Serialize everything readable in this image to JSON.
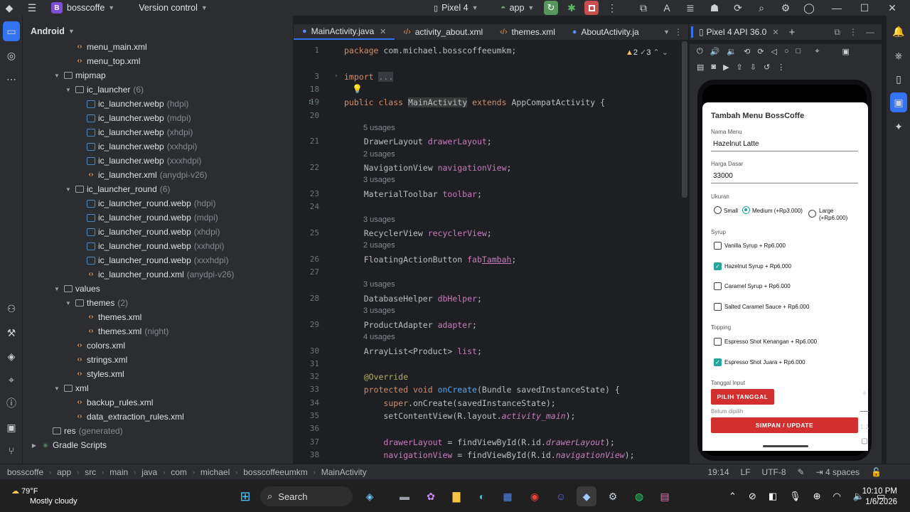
{
  "titlebar": {
    "project_initial": "B",
    "project": "bosscoffe",
    "vcs": "Version control",
    "device": "Pixel 4",
    "run_config": "app"
  },
  "project": {
    "view": "Android",
    "tree": [
      {
        "d": 4,
        "t": "xml",
        "label": "menu_main.xml",
        "gray": ""
      },
      {
        "d": 4,
        "t": "xml",
        "label": "menu_top.xml",
        "gray": ""
      },
      {
        "d": 3,
        "t": "folder",
        "label": "mipmap",
        "gray": "",
        "open": true
      },
      {
        "d": 4,
        "t": "folder",
        "label": "ic_launcher",
        "gray": "(6)",
        "open": true
      },
      {
        "d": 5,
        "t": "img",
        "label": "ic_launcher.webp",
        "gray": "(hdpi)"
      },
      {
        "d": 5,
        "t": "img",
        "label": "ic_launcher.webp",
        "gray": "(mdpi)"
      },
      {
        "d": 5,
        "t": "img",
        "label": "ic_launcher.webp",
        "gray": "(xhdpi)"
      },
      {
        "d": 5,
        "t": "img",
        "label": "ic_launcher.webp",
        "gray": "(xxhdpi)"
      },
      {
        "d": 5,
        "t": "img",
        "label": "ic_launcher.webp",
        "gray": "(xxxhdpi)"
      },
      {
        "d": 5,
        "t": "xml",
        "label": "ic_launcher.xml",
        "gray": "(anydpi-v26)"
      },
      {
        "d": 4,
        "t": "folder",
        "label": "ic_launcher_round",
        "gray": "(6)",
        "open": true
      },
      {
        "d": 5,
        "t": "img",
        "label": "ic_launcher_round.webp",
        "gray": "(hdpi)"
      },
      {
        "d": 5,
        "t": "img",
        "label": "ic_launcher_round.webp",
        "gray": "(mdpi)"
      },
      {
        "d": 5,
        "t": "img",
        "label": "ic_launcher_round.webp",
        "gray": "(xhdpi)"
      },
      {
        "d": 5,
        "t": "img",
        "label": "ic_launcher_round.webp",
        "gray": "(xxhdpi)"
      },
      {
        "d": 5,
        "t": "img",
        "label": "ic_launcher_round.webp",
        "gray": "(xxxhdpi)"
      },
      {
        "d": 5,
        "t": "xml",
        "label": "ic_launcher_round.xml",
        "gray": "(anydpi-v26)"
      },
      {
        "d": 3,
        "t": "folder",
        "label": "values",
        "gray": "",
        "open": true
      },
      {
        "d": 4,
        "t": "folder",
        "label": "themes",
        "gray": "(2)",
        "open": true
      },
      {
        "d": 5,
        "t": "xml",
        "label": "themes.xml",
        "gray": ""
      },
      {
        "d": 5,
        "t": "xml",
        "label": "themes.xml",
        "gray": "(night)"
      },
      {
        "d": 4,
        "t": "xml",
        "label": "colors.xml",
        "gray": ""
      },
      {
        "d": 4,
        "t": "xml",
        "label": "strings.xml",
        "gray": ""
      },
      {
        "d": 4,
        "t": "xml",
        "label": "styles.xml",
        "gray": ""
      },
      {
        "d": 3,
        "t": "folder",
        "label": "xml",
        "gray": "",
        "open": true
      },
      {
        "d": 4,
        "t": "xml",
        "label": "backup_rules.xml",
        "gray": ""
      },
      {
        "d": 4,
        "t": "xml",
        "label": "data_extraction_rules.xml",
        "gray": ""
      },
      {
        "d": 2,
        "t": "folder",
        "label": "res",
        "gray": "(generated)"
      },
      {
        "d": 1,
        "t": "gradle",
        "label": "Gradle Scripts",
        "gray": "",
        "closed": true
      }
    ]
  },
  "tabs": [
    "MainActivity.java",
    "activity_about.xml",
    "themes.xml",
    "AboutActivity.ja"
  ],
  "editor": {
    "warnings": "2",
    "weak": "3",
    "lines": [
      {
        "n": "1",
        "html": "<span class='kw'>package</span> com.michael.bosscoffeeumkm;"
      },
      {
        "n": "",
        "html": ""
      },
      {
        "n": "3",
        "html": "<span class='kw'>import</span> <span style='background:#393b40;color:#868a91'>...</span>"
      },
      {
        "n": "18",
        "html": ""
      },
      {
        "n": "19",
        "html": "<span class='kw'>public class</span> <span style='background:#373b39'>MainActivity</span> <span class='kw'>extends</span> AppCompatActivity {"
      },
      {
        "n": "20",
        "html": ""
      },
      {
        "n": "21",
        "u": "5 usages",
        "html": "    DrawerLayout <span class='fld'>drawerLayout</span>;"
      },
      {
        "n": "22",
        "u": "2 usages",
        "html": "    NavigationView <span class='fld'>navigationView</span>;"
      },
      {
        "n": "23",
        "u": "3 usages",
        "html": "    MaterialToolbar <span class='fld'>toolbar</span>;"
      },
      {
        "n": "24",
        "html": ""
      },
      {
        "n": "25",
        "u": "3 usages",
        "html": "    RecyclerView <span class='fld'>recyclerView</span>;"
      },
      {
        "n": "26",
        "u": "2 usages",
        "html": "    FloatingActionButton <span class='fld'>fab<u>Tambah</u></span>;"
      },
      {
        "n": "27",
        "html": ""
      },
      {
        "n": "28",
        "u": "3 usages",
        "html": "    DatabaseHelper <span class='fld'>dbHelper</span>;"
      },
      {
        "n": "29",
        "u": "3 usages",
        "html": "    ProductAdapter <span class='fld'>adapter</span>;"
      },
      {
        "n": "30",
        "u": "4 usages",
        "html": "    ArrayList&lt;Product&gt; <span class='fld'>list</span>;"
      },
      {
        "n": "31",
        "html": ""
      },
      {
        "n": "32",
        "html": "    <span class='an'>@Override</span>"
      },
      {
        "n": "33",
        "html": "    <span class='kw'>protected void</span> <span class='fn'>onCreate</span>(Bundle savedInstanceState) {"
      },
      {
        "n": "34",
        "html": "        <span class='kw'>super</span>.onCreate(savedInstanceState);"
      },
      {
        "n": "35",
        "html": "        setContentView(R.layout.<span class='it'>activity_main</span>);"
      },
      {
        "n": "36",
        "html": ""
      },
      {
        "n": "37",
        "html": "        <span class='fld'>drawerLayout</span> = findViewById(R.id.<span class='it'>drawerLayout</span>);"
      },
      {
        "n": "38",
        "html": "        <span class='fld'>navigationView</span> = findViewById(R.id.<span class='it'>navigationView</span>);"
      }
    ]
  },
  "emulator": {
    "title": "Pixel 4 API 36.0"
  },
  "app": {
    "title": "Tambah Menu BossCoffe",
    "nama_label": "Nama Menu",
    "nama_value": "Hazelnut Latte",
    "harga_label": "Harga Dasar",
    "harga_value": "33000",
    "ukuran_label": "Ukuran",
    "sizes": [
      "Small",
      "Medium (+Rp3.000)",
      "Large (+Rp6.000)"
    ],
    "size_selected": "Medium (+Rp3.000)",
    "syrup_label": "Syrup",
    "syrups": [
      {
        "label": "Vanilla Syrup + Rp6.000",
        "checked": false
      },
      {
        "label": "Hazelnut Syrup + Rp6.000",
        "checked": true
      },
      {
        "label": "Caramel Syrup + Rp6.000",
        "checked": false
      },
      {
        "label": "Salted Caramel Sauce + Rp6.000",
        "checked": false
      }
    ],
    "topping_label": "Topping",
    "toppings": [
      {
        "label": "Espresso Shot Kenangan + Rp6.000",
        "checked": false
      },
      {
        "label": "Espresso Shot Juara + Rp6.000",
        "checked": true
      }
    ],
    "tanggal_label": "Tanggal Input",
    "pilih_button": "PILIH TANGGAL",
    "belum": "Belum dipilih",
    "simpan_button": "SIMPAN / UPDATE",
    "zoom_ratio": "1:1"
  },
  "status": {
    "crumbs": [
      "bosscoffe",
      "app",
      "src",
      "main",
      "java",
      "com",
      "michael",
      "bosscoffeeumkm",
      "MainActivity"
    ],
    "position": "19:14",
    "line_sep": "LF",
    "encoding": "UTF-8",
    "indent": "4 spaces"
  },
  "taskbar": {
    "temp": "79°F",
    "weather": "Mostly cloudy",
    "search": "Search",
    "time": "10:10 PM",
    "date": "1/6/2026"
  }
}
